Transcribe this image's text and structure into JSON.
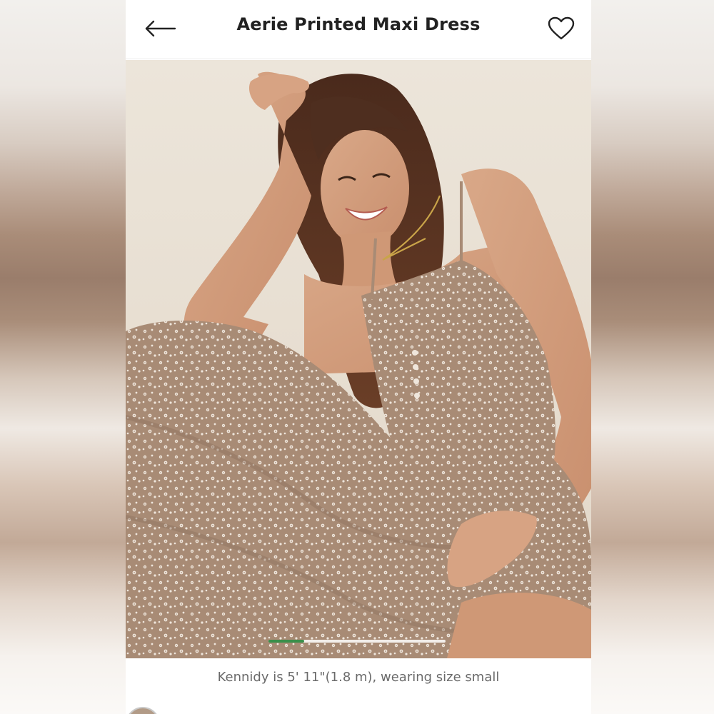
{
  "header": {
    "title": "Aerie Printed Maxi Dress",
    "back_icon": "arrow-left-icon",
    "favorite_icon": "heart-outline-icon"
  },
  "gallery": {
    "image_alt": "Model smiling in brown floral printed maxi dress",
    "progress": 0.2,
    "progress_color": "#3a8f4a"
  },
  "caption": "Kennidy is 5' 11\"(1.8 m), wearing size small",
  "colors": {
    "dress": "#a88b75",
    "print": "#efe6dc",
    "wall": "#e9e1d5"
  }
}
